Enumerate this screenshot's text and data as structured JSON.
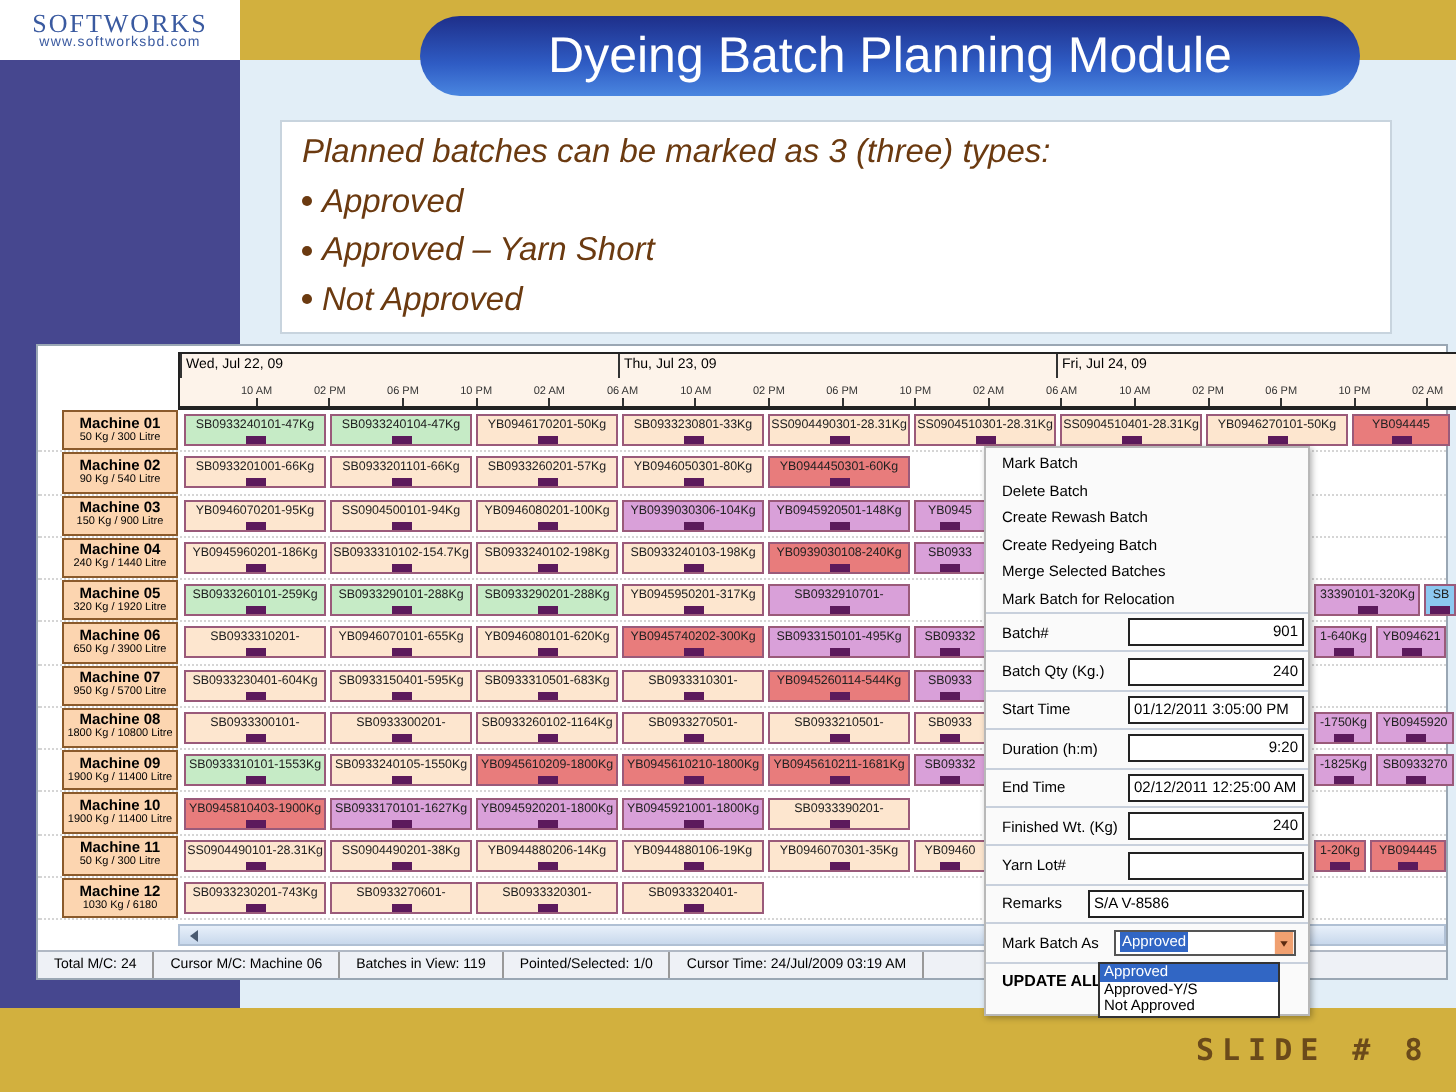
{
  "logo": {
    "name": "SOFTWORKS",
    "url": "www.softworksbd.com"
  },
  "slide_title": "Dyeing Batch Planning Module",
  "notes": {
    "intro": "Planned batches can be marked as 3 (three) types:",
    "bullets": [
      "Approved",
      "Approved – Yarn Short",
      "Not Approved"
    ]
  },
  "planner": {
    "dates": [
      "Wed, Jul 22, 09",
      "Thu, Jul 23, 09",
      "Fri, Jul 24, 09"
    ],
    "times": [
      "10 AM",
      "02 PM",
      "06 PM",
      "10 PM",
      "02 AM",
      "06 AM",
      "10 AM",
      "02 PM",
      "06 PM",
      "10 PM",
      "02 AM",
      "06 AM",
      "10 AM",
      "02 PM",
      "06 PM",
      "10 PM",
      "02 AM"
    ],
    "rows": [
      {
        "machine": "Machine 01",
        "capacity": "50 Kg / 300 Litre",
        "bars": [
          {
            "label": "SB0933240101-47Kg",
            "color": "#c6ebc6"
          },
          {
            "label": "SB0933240104-47Kg",
            "color": "#c6ebc6"
          },
          {
            "label": "YB0946170201-50Kg",
            "color": "#fde6cf"
          },
          {
            "label": "SB0933230801-33Kg",
            "color": "#fde6cf"
          },
          {
            "label": "SS0904490301-28.31Kg",
            "color": "#fde6cf"
          },
          {
            "label": "SS0904510301-28.31Kg",
            "color": "#fde6cf"
          },
          {
            "label": "SS0904510401-28.31Kg",
            "color": "#fde6cf"
          },
          {
            "label": "YB0946270101-50Kg",
            "color": "#fde6cf"
          },
          {
            "label": "YB094445",
            "color": "#e87c7c"
          }
        ]
      },
      {
        "machine": "Machine 02",
        "capacity": "90 Kg / 540 Litre",
        "bars": [
          {
            "label": "SB0933201001-66Kg",
            "color": "#fde6cf"
          },
          {
            "label": "SB0933201101-66Kg",
            "color": "#fde6cf"
          },
          {
            "label": "SB0933260201-57Kg",
            "color": "#fde6cf"
          },
          {
            "label": "YB0946050301-80Kg",
            "color": "#fde6cf"
          },
          {
            "label": "YB0944450301-60Kg",
            "color": "#e87c7c"
          }
        ]
      },
      {
        "machine": "Machine 03",
        "capacity": "150 Kg / 900 Litre",
        "bars": [
          {
            "label": "YB0946070201-95Kg",
            "color": "#fde6cf"
          },
          {
            "label": "SS0904500101-94Kg",
            "color": "#fde6cf"
          },
          {
            "label": "YB0946080201-100Kg",
            "color": "#fde6cf"
          },
          {
            "label": "YB0939030306-104Kg",
            "color": "#d9a0d9"
          },
          {
            "label": "YB0945920501-148Kg",
            "color": "#d9a0d9"
          },
          {
            "label": "YB0945",
            "color": "#d9a0d9"
          }
        ]
      },
      {
        "machine": "Machine 04",
        "capacity": "240 Kg / 1440 Litre",
        "bars": [
          {
            "label": "YB0945960201-186Kg",
            "color": "#fde6cf"
          },
          {
            "label": "SB0933310102-154.7Kg",
            "color": "#fde6cf"
          },
          {
            "label": "SB0933240102-198Kg",
            "color": "#fde6cf"
          },
          {
            "label": "SB0933240103-198Kg",
            "color": "#fde6cf"
          },
          {
            "label": "YB0939030108-240Kg",
            "color": "#e87c7c"
          },
          {
            "label": "SB0933",
            "color": "#d9a0d9"
          }
        ]
      },
      {
        "machine": "Machine 05",
        "capacity": "320 Kg / 1920 Litre",
        "bars": [
          {
            "label": "SB0933260101-259Kg",
            "color": "#c6ebc6"
          },
          {
            "label": "SB0933290101-288Kg",
            "color": "#c6ebc6"
          },
          {
            "label": "SB0933290201-288Kg",
            "color": "#c6ebc6"
          },
          {
            "label": "YB0945950201-317Kg",
            "color": "#fde6cf"
          },
          {
            "label": "SB0932910701-",
            "color": "#d9a0d9"
          }
        ],
        "bars_after_menu": [
          {
            "label": "33390101-320Kg",
            "color": "#d9a0d9"
          },
          {
            "label": "SB",
            "color": "#8cc8f0"
          }
        ]
      },
      {
        "machine": "Machine 06",
        "capacity": "650 Kg / 3900 Litre",
        "bars": [
          {
            "label": "SB0933310201-",
            "color": "#fde6cf"
          },
          {
            "label": "YB0946070101-655Kg",
            "color": "#fde6cf"
          },
          {
            "label": "YB0946080101-620Kg",
            "color": "#fde6cf"
          },
          {
            "label": "YB0945740202-300Kg",
            "color": "#e87c7c"
          },
          {
            "label": "SB0933150101-495Kg",
            "color": "#d9a0d9"
          },
          {
            "label": "SB09332",
            "color": "#d9a0d9"
          }
        ],
        "bars_after_menu": [
          {
            "label": "1-640Kg",
            "color": "#d9a0d9"
          },
          {
            "label": "YB094621",
            "color": "#d9a0d9"
          }
        ]
      },
      {
        "machine": "Machine 07",
        "capacity": "950 Kg / 5700 Litre",
        "bars": [
          {
            "label": "SB0933230401-604Kg",
            "color": "#fde6cf"
          },
          {
            "label": "SB0933150401-595Kg",
            "color": "#fde6cf"
          },
          {
            "label": "SB0933310501-683Kg",
            "color": "#fde6cf"
          },
          {
            "label": "SB0933310301-",
            "color": "#fde6cf"
          },
          {
            "label": "YB0945260114-544Kg",
            "color": "#e87c7c"
          },
          {
            "label": "SB0933",
            "color": "#d9a0d9"
          }
        ]
      },
      {
        "machine": "Machine 08",
        "capacity": "1800 Kg / 10800 Litre",
        "bars": [
          {
            "label": "SB0933300101-",
            "color": "#fde6cf"
          },
          {
            "label": "SB0933300201-",
            "color": "#fde6cf"
          },
          {
            "label": "SB0933260102-1164Kg",
            "color": "#fde6cf"
          },
          {
            "label": "SB0933270501-",
            "color": "#fde6cf"
          },
          {
            "label": "SB0933210501-",
            "color": "#fde6cf"
          },
          {
            "label": "SB0933",
            "color": "#fde6cf"
          }
        ],
        "bars_after_menu": [
          {
            "label": "-1750Kg",
            "color": "#d9a0d9"
          },
          {
            "label": "YB0945920",
            "color": "#d9a0d9"
          }
        ]
      },
      {
        "machine": "Machine 09",
        "capacity": "1900 Kg / 11400 Litre",
        "bars": [
          {
            "label": "SB0933310101-1553Kg",
            "color": "#c6ebc6"
          },
          {
            "label": "SB0933240105-1550Kg",
            "color": "#fde6cf"
          },
          {
            "label": "YB0945610209-1800Kg",
            "color": "#e87c7c"
          },
          {
            "label": "YB0945610210-1800Kg",
            "color": "#e87c7c"
          },
          {
            "label": "YB0945610211-1681Kg",
            "color": "#e87c7c"
          },
          {
            "label": "SB09332",
            "color": "#d9a0d9"
          }
        ],
        "bars_after_menu": [
          {
            "label": "-1825Kg",
            "color": "#d9a0d9"
          },
          {
            "label": "SB0933270",
            "color": "#d9a0d9"
          }
        ]
      },
      {
        "machine": "Machine 10",
        "capacity": "1900 Kg / 11400 Litre",
        "bars": [
          {
            "label": "YB0945810403-1900Kg",
            "color": "#e87c7c"
          },
          {
            "label": "SB0933170101-1627Kg",
            "color": "#d9a0d9"
          },
          {
            "label": "YB0945920201-1800Kg",
            "color": "#d9a0d9"
          },
          {
            "label": "YB0945921001-1800Kg",
            "color": "#d9a0d9"
          },
          {
            "label": "SB0933390201-",
            "color": "#fde6cf"
          }
        ]
      },
      {
        "machine": "Machine 11",
        "capacity": "50 Kg / 300 Litre",
        "bars": [
          {
            "label": "SS0904490101-28.31Kg",
            "color": "#fde6cf"
          },
          {
            "label": "SS0904490201-38Kg",
            "color": "#fde6cf"
          },
          {
            "label": "YB0944880206-14Kg",
            "color": "#fde6cf"
          },
          {
            "label": "YB0944880106-19Kg",
            "color": "#fde6cf"
          },
          {
            "label": "YB0946070301-35Kg",
            "color": "#fde6cf"
          },
          {
            "label": "YB09460",
            "color": "#fde6cf"
          }
        ],
        "bars_after_menu": [
          {
            "label": "1-20Kg",
            "color": "#e87c7c"
          },
          {
            "label": "YB094445",
            "color": "#e87c7c"
          }
        ]
      },
      {
        "machine": "Machine 12",
        "capacity": "1030 Kg / 6180",
        "bars": [
          {
            "label": "SB0933230201-743Kg",
            "color": "#fde6cf"
          },
          {
            "label": "SB0933270601-",
            "color": "#fde6cf"
          },
          {
            "label": "SB0933320301-",
            "color": "#fde6cf"
          },
          {
            "label": "SB0933320401-",
            "color": "#fde6cf"
          }
        ]
      }
    ],
    "status_bar": [
      "Total M/C: 24",
      "Cursor M/C: Machine 06",
      "Batches in View: 119",
      "Pointed/Selected: 1/0",
      "Cursor Time: 24/Jul/2009 03:19 AM"
    ]
  },
  "context_menu": {
    "items": [
      "Mark Batch",
      "Delete Batch",
      "Create Rewash Batch",
      "Create Redyeing Batch",
      "Merge Selected Batches",
      "Mark Batch for Relocation"
    ],
    "fields": [
      {
        "label": "Batch#",
        "value": "901",
        "kind": "number"
      },
      {
        "label": "Batch Qty (Kg.)",
        "value": "240",
        "kind": "number"
      },
      {
        "label": "Start Time",
        "value": "01/12/2011 3:05:00 PM",
        "kind": "text"
      },
      {
        "label": "Duration (h:m)",
        "value": "9:20",
        "kind": "number"
      },
      {
        "label": "End Time",
        "value": "02/12/2011 12:25:00 AM",
        "kind": "text"
      },
      {
        "label": "Finished Wt. (Kg)",
        "value": "240",
        "kind": "number"
      },
      {
        "label": "Yarn Lot#",
        "kind": "text"
      },
      {
        "label": "Remarks",
        "value": "S/A V-8586",
        "kind": "note"
      }
    ],
    "mark_as": {
      "label": "Mark Batch As",
      "value": "Approved",
      "expanded": true,
      "options": [
        {
          "label": "Approved",
          "selected": true
        },
        {
          "label": "Approved-Y/S",
          "selected": false
        },
        {
          "label": "Not Approved",
          "selected": false
        }
      ]
    },
    "update_button": "UPDATE ALL"
  },
  "slide_number": "SLIDE # 8"
}
